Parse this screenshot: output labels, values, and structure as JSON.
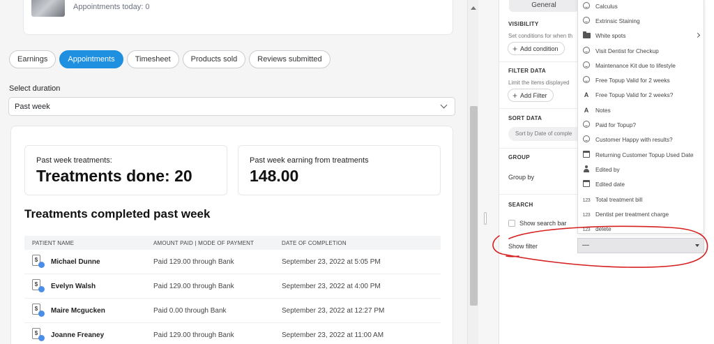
{
  "profile": {
    "appointments_today": "Appointments today: 0"
  },
  "tabs": [
    "Earnings",
    "Appointments",
    "Timesheet",
    "Products sold",
    "Reviews submitted"
  ],
  "active_tab": "Appointments",
  "duration": {
    "label": "Select duration",
    "value": "Past week"
  },
  "stats": [
    {
      "label": "Past week treatments:",
      "value": "Treatments done: 20"
    },
    {
      "label": "Past week earning from treatments",
      "value": "148.00"
    }
  ],
  "section_title": "Treatments completed past week",
  "table": {
    "columns": [
      "PATIENT NAME",
      "AMOUNT PAID | MODE OF PAYMENT",
      "DATE OF COMPLETION"
    ],
    "rows": [
      {
        "name": "Michael Dunne",
        "paid": "Paid 129.00 through Bank",
        "date": "September 23, 2022 at 5:05 PM"
      },
      {
        "name": "Evelyn Walsh",
        "paid": "Paid 129.00 through Bank",
        "date": "September 23, 2022 at 4:00 PM"
      },
      {
        "name": "Maire Mcgucken",
        "paid": "Paid 0.00 through Bank",
        "date": "September 23, 2022 at 12:27 PM"
      },
      {
        "name": "Joanne Freaney",
        "paid": "Paid 129.00 through Bank",
        "date": "September 23, 2022 at 11:00 AM"
      }
    ]
  },
  "panel": {
    "segment_label": "General",
    "visibility": {
      "title": "VISIBILITY",
      "desc": "Set conditions for when th",
      "button": "Add condition"
    },
    "filter_data": {
      "title": "FILTER DATA",
      "desc": "Limit the items displayed",
      "button": "Add Filter"
    },
    "sort_data": {
      "title": "SORT DATA",
      "value": "Sort by Date of comple"
    },
    "group": {
      "title": "GROUP",
      "label": "Group by"
    },
    "search": {
      "title": "SEARCH",
      "show_search_bar": "Show search bar"
    },
    "show_filter": {
      "label": "Show filter",
      "value": "—"
    }
  },
  "dropdown": {
    "items": [
      {
        "icon": "smile",
        "label": "Calculus"
      },
      {
        "icon": "smile",
        "label": "Extrinsic Staining"
      },
      {
        "icon": "folder",
        "label": "White spots",
        "submenu": true
      },
      {
        "icon": "smile",
        "label": "Visit Dentist for Checkup"
      },
      {
        "icon": "smile",
        "label": "Maintenance Kit due to lifestyle"
      },
      {
        "icon": "smile",
        "label": "Free Topup Valid for 2 weeks"
      },
      {
        "icon": "text",
        "label": "Free Topup Valid for 2 weeks?"
      },
      {
        "icon": "text",
        "label": "Notes"
      },
      {
        "icon": "smile",
        "label": "Paid for Topup?"
      },
      {
        "icon": "smile",
        "label": "Customer Happy with results?"
      },
      {
        "icon": "calendar",
        "label": "Returning Customer Topup Used Date"
      },
      {
        "icon": "person",
        "label": "Edited by"
      },
      {
        "icon": "calendar",
        "label": "Edited date"
      },
      {
        "icon": "number",
        "label": "Total treatment bill"
      },
      {
        "icon": "number",
        "label": "Dentist per treatment charge"
      },
      {
        "icon": "number",
        "label": "delete"
      }
    ]
  },
  "colors": {
    "accent": "#1f8fe0",
    "annotation": "#d62020"
  }
}
